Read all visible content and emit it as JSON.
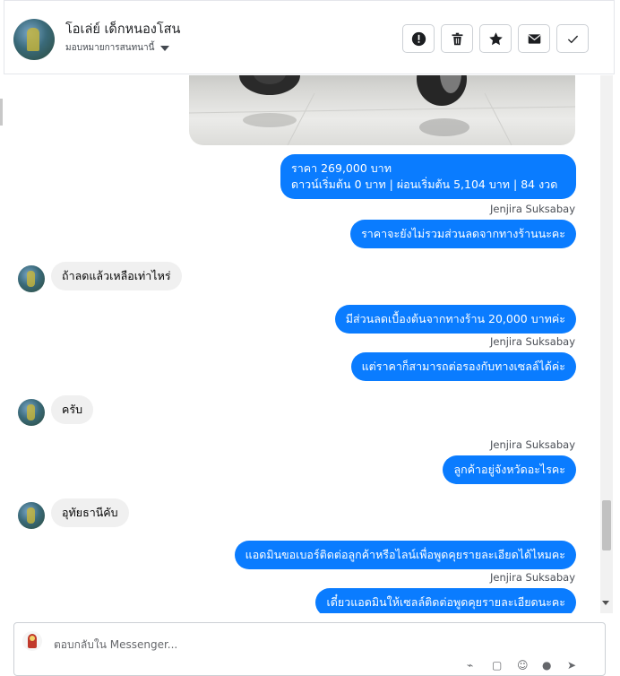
{
  "header": {
    "name": "โอเล่ย์ เด็กหนองโสน",
    "assign_label": "มอบหมายการสนทนานี้",
    "actions": [
      {
        "name": "report-button",
        "icon": "exclamation-icon"
      },
      {
        "name": "delete-button",
        "icon": "trash-icon"
      },
      {
        "name": "star-button",
        "icon": "star-icon"
      },
      {
        "name": "mark-unread-button",
        "icon": "envelope-icon"
      },
      {
        "name": "mark-done-button",
        "icon": "check-icon"
      }
    ]
  },
  "messages": {
    "m1_line1": "ราคา 269,000 บาท",
    "m1_line2": "ดาวน์เริ่มต้น 0 บาท | ผ่อนเริ่มต้น 5,104 บาท | 84 งวด",
    "m1_sender": "Jenjira Suksabay",
    "m2": "ราคาจะยังไม่รวมส่วนลดจากทางร้านนะคะ",
    "m3": "ถ้าลดแล้วเหลือเท่าไหร่",
    "m4": "มีส่วนลดเบื้องต้นจากทางร้าน 20,000 บาทค่ะ",
    "m4_sender": "Jenjira Suksabay",
    "m5": "แต่ราคาก็สามารถต่อรองกับทางเซลล์ได้ค่ะ",
    "m6": "ครับ",
    "m7_sender": "Jenjira Suksabay",
    "m7": "ลูกค้าอยู่จังหวัดอะไรคะ",
    "m8": "อุทัยธานีคับ",
    "m9": "แอดมินขอเบอร์ติดต่อลูกค้าหรือไลน์เพื่อพูดคุยรายละเอียดได้ไหมคะ",
    "m9_sender": "Jenjira Suksabay",
    "m10": "เดี๋ยวแอดมินให้เซลล์ติดต่อพูดคุยรายละเอียดนะคะ"
  },
  "composer": {
    "placeholder": "ตอบกลับใน Messenger..."
  },
  "colors": {
    "outgoing": "#0a7cff",
    "incoming": "#f0f0f0"
  }
}
